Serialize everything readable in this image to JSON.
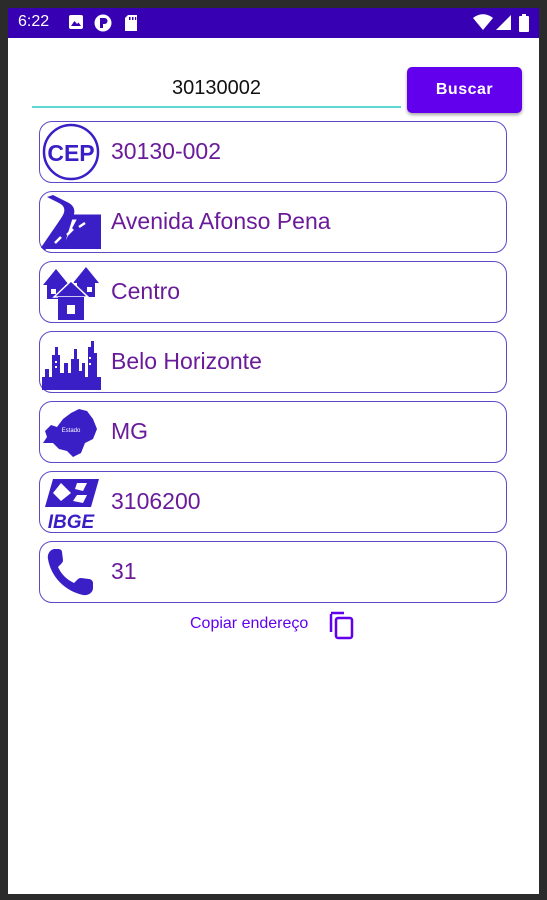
{
  "status_bar": {
    "time": "6:22"
  },
  "search": {
    "value": "30130002",
    "button_label": "Buscar"
  },
  "results": [
    {
      "icon": "cep-icon",
      "value": "30130-002"
    },
    {
      "icon": "road-icon",
      "value": "Avenida Afonso Pena"
    },
    {
      "icon": "houses-icon",
      "value": "Centro"
    },
    {
      "icon": "city-skyline-icon",
      "value": "Belo Horizonte"
    },
    {
      "icon": "state-map-icon",
      "value": "MG",
      "icon_text": "Estado"
    },
    {
      "icon": "ibge-logo-icon",
      "value": "3106200",
      "icon_text": "IBGE"
    },
    {
      "icon": "phone-icon",
      "value": "31"
    }
  ],
  "copy": {
    "label": "Copiar endereço",
    "icon": "copy-icon"
  },
  "colors": {
    "status_bar": "#3700b3",
    "accent": "#6200ee",
    "card_border": "#5f47c7",
    "result_text": "#6a1b9a",
    "icon": "#3a1fc7",
    "input_underline": "#5ed6d1"
  }
}
